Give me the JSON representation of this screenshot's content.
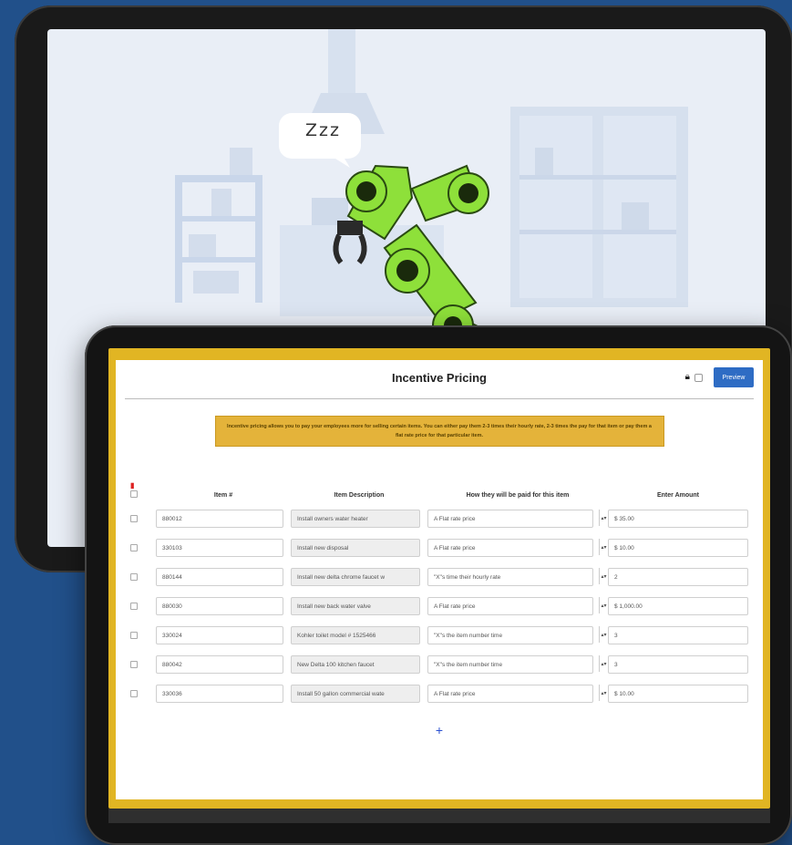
{
  "app": {
    "title": "Incentive Pricing",
    "lock_icon": "lock-icon",
    "preview_label": "Preview",
    "notice": "Incentive pricing allows you to pay your employees more for selling certain items. You can either pay them 2-3 times their hourly rate, 2-3 times the pay for that item or pay them a flat rate price for that particular item."
  },
  "illustration": {
    "bubble_text": "Zzz"
  },
  "table": {
    "headers": [
      "Item #",
      "Item Description",
      "How they will be paid for this item",
      "Enter Amount"
    ],
    "rows": [
      {
        "item": "880012",
        "description": "Install owners water heater",
        "method": "A Flat rate price",
        "amount": "$ 35.00"
      },
      {
        "item": "330103",
        "description": "Install new disposal",
        "method": "A Flat rate price",
        "amount": "$ 10.00"
      },
      {
        "item": "880144",
        "description": "Install new delta chrome faucet w",
        "method": "\"X\"s time their hourly rate",
        "amount": "2"
      },
      {
        "item": "880030",
        "description": "Install new back water valve",
        "method": "A Flat rate price",
        "amount": "$ 1,000.00"
      },
      {
        "item": "330024",
        "description": "Kohler toilet model # 1525466",
        "method": "\"X\"s the item number time",
        "amount": "3"
      },
      {
        "item": "880042",
        "description": "New Delta 100 kitchen faucet",
        "method": "\"X\"s the item number time",
        "amount": "3"
      },
      {
        "item": "330036",
        "description": "Install 50 gallon commercial wate",
        "method": "A Flat rate price",
        "amount": "$ 10.00"
      }
    ]
  },
  "colors": {
    "background": "#21508a",
    "accent_yellow": "#e1b523",
    "preview_button": "#2e6cc4",
    "robot_green": "#8ee03a"
  }
}
